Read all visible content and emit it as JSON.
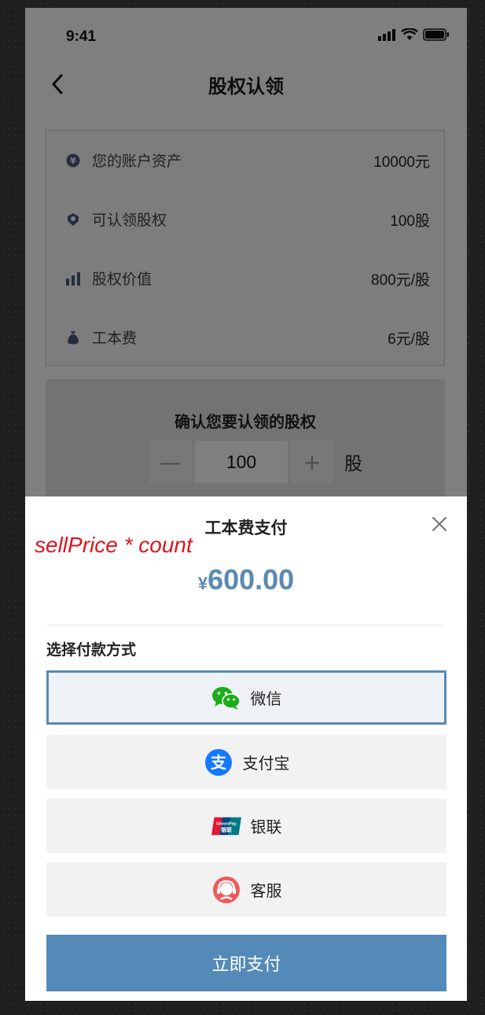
{
  "status": {
    "time": "9:41"
  },
  "nav": {
    "title": "股权认领"
  },
  "info": {
    "rows": [
      {
        "icon": "yuan-coin-icon",
        "label": "您的账户资产",
        "value": "10000元"
      },
      {
        "icon": "badge-icon",
        "label": "可认领股权",
        "value": "100股"
      },
      {
        "icon": "bar-chart-icon",
        "label": "股权价值",
        "value": "800元/股"
      },
      {
        "icon": "money-bag-icon",
        "label": "工本费",
        "value": "6元/股"
      }
    ]
  },
  "confirm": {
    "title": "确认您要认领的股权",
    "minus": "—",
    "plus": "+",
    "quantity": "100",
    "unit": "股"
  },
  "sheet": {
    "title": "工本费支付",
    "annotation": "sellPrice * count",
    "currency": "¥",
    "amount": "600.00",
    "method_label": "选择付款方式",
    "options": [
      {
        "icon": "wechat-icon",
        "label": "微信",
        "selected": true
      },
      {
        "icon": "alipay-icon",
        "label": "支付宝",
        "selected": false
      },
      {
        "icon": "unionpay-icon",
        "label": "银联",
        "selected": false
      },
      {
        "icon": "customer-service-icon",
        "label": "客服",
        "selected": false
      }
    ],
    "pay_button": "立即支付"
  },
  "colors": {
    "accent": "#538ab8",
    "amount": "#5a8ab2",
    "annotation": "#e0141e",
    "wechat": "#1aad19",
    "alipay": "#1678ff",
    "service": "#f05a5a"
  }
}
